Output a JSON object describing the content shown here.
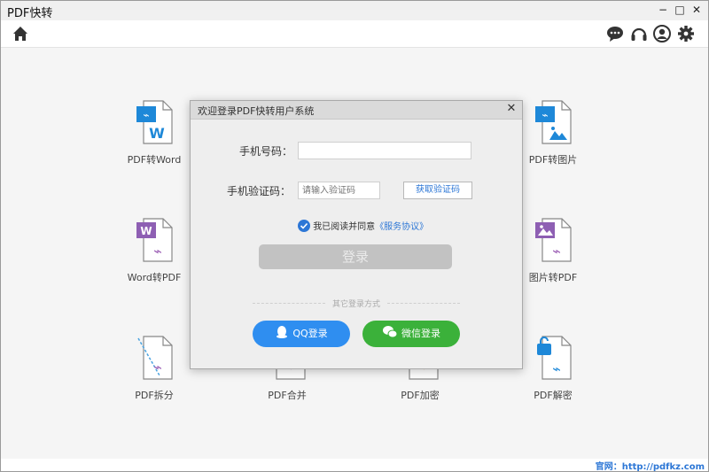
{
  "app": {
    "title": "PDF快转"
  },
  "window_controls": {
    "minimize": "−",
    "maximize": "□",
    "close": "✕"
  },
  "toolbar": {
    "left_icon": "home-icon",
    "right_icons": [
      "chat-icon",
      "headset-icon",
      "user-icon",
      "gear-icon"
    ]
  },
  "tools": {
    "pdf_to_word": "PDF转Word",
    "pdf_to_image": "PDF转图片",
    "word_to_pdf": "Word转PDF",
    "image_to_pdf": "图片转PDF",
    "pdf_split": "PDF拆分",
    "pdf_merge": "PDF合并",
    "pdf_encrypt": "PDF加密",
    "pdf_decrypt": "PDF解密"
  },
  "dialog": {
    "title": "欢迎登录PDF快转用户系统",
    "close": "✕",
    "phone_label": "手机号码：",
    "phone_value": "",
    "code_label": "手机验证码：",
    "code_placeholder": "请输入验证码",
    "get_code": "获取验证码",
    "agree_text": "我已阅读并同意",
    "agree_link": "《服务协议》",
    "agreed": true,
    "login": "登录",
    "other_login": "其它登录方式",
    "qq_login": "QQ登录",
    "wechat_login": "微信登录"
  },
  "footer": {
    "link": "官网：http://pdfkz.com"
  },
  "colors": {
    "accent": "#2d77d6",
    "qq": "#2f8ef0",
    "wechat": "#3bb13a",
    "word_blue": "#1e88d8",
    "word_purple": "#8e5fb3",
    "pdf_purple": "#9c5fb5",
    "login_disabled": "#c2c2c2"
  }
}
